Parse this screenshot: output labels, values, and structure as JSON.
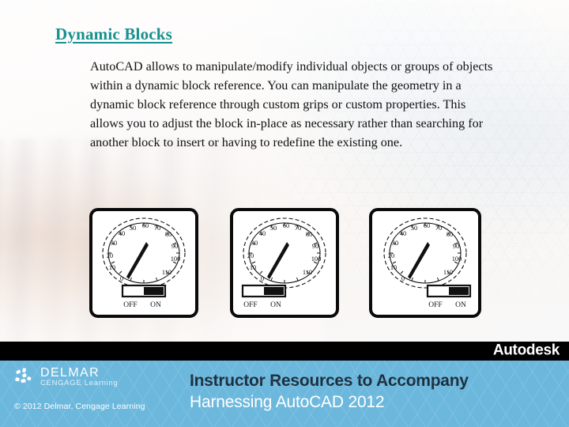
{
  "slide": {
    "title": "Dynamic Blocks",
    "title_color": "#16918f",
    "body": "AutoCAD allows to manipulate/modify individual objects or groups of objects within a dynamic block reference. You can manipulate the geometry in a dynamic block reference through custom grips or custom properties. This allows you to adjust the block in-place as necessary rather than searching for another block to insert or having to redefine the existing one."
  },
  "gauge": {
    "tick_labels": [
      "0",
      "10",
      "20",
      "30",
      "40",
      "50",
      "60",
      "70",
      "80",
      "90",
      "100",
      "110"
    ],
    "needle_value": 78,
    "scale_min": 0,
    "scale_max": 110,
    "switch_off_label": "OFF",
    "switch_on_label": "ON"
  },
  "panels": [
    {
      "name": "panel-gauge-centered",
      "switch_position": "center"
    },
    {
      "name": "panel-gauge-left",
      "switch_position": "left"
    },
    {
      "name": "panel-gauge-right",
      "switch_position": "right"
    }
  ],
  "footer": {
    "autodesk": "Autodesk",
    "delmar_name": "DELMAR",
    "delmar_sub": "CENGAGE Learning",
    "copyright": "© 2012 Delmar, Cengage Learning",
    "series_line1": "Instructor Resources to Accompany",
    "series_line2": "Harnessing AutoCAD 2012",
    "bar_black": "#000000",
    "bar_blue": "#6cb8dd"
  }
}
